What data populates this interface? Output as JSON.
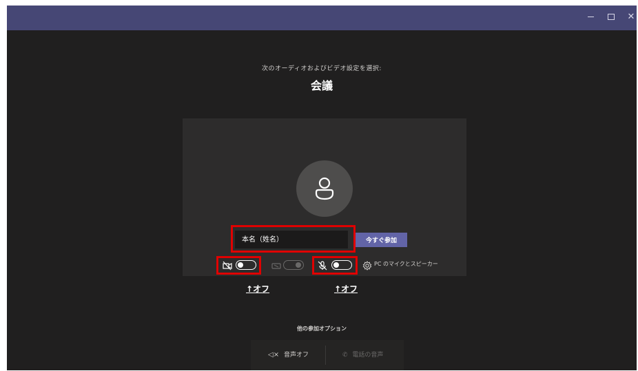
{
  "window": {
    "controls": {
      "minimize_icon": "minimize-icon",
      "maximize_icon": "maximize-icon",
      "close_icon": "close-icon",
      "close_glyph": "✕"
    },
    "titlebar_color": "#464775"
  },
  "header": {
    "subtitle": "次のオーディオおよびビデオ設定を選択:",
    "meeting_title": "会議"
  },
  "preview": {
    "avatar_icon": "person-icon",
    "name_placeholder": "本名（姓名）",
    "join_label": "今すぐ参加"
  },
  "controls": {
    "camera": {
      "icon": "camera-off-icon",
      "on": false
    },
    "blur": {
      "icon": "background-blur-icon",
      "on": false,
      "disabled": true
    },
    "microphone": {
      "icon": "mic-off-icon",
      "on": false
    },
    "device_settings_icon": "gear-icon",
    "device_settings_label": "PC のマイクとスピーカー"
  },
  "annotations": {
    "camera_note": "↑オフ",
    "mic_note": "↑オフ",
    "highlight_color": "#e00000"
  },
  "other_options": {
    "heading": "他の参加オプション",
    "audio_off_label": "音声オフ",
    "audio_off_icon": "speaker-off-icon",
    "phone_audio_label": "電話の音声",
    "phone_audio_icon": "phone-icon"
  },
  "accent_color": "#6264a7"
}
